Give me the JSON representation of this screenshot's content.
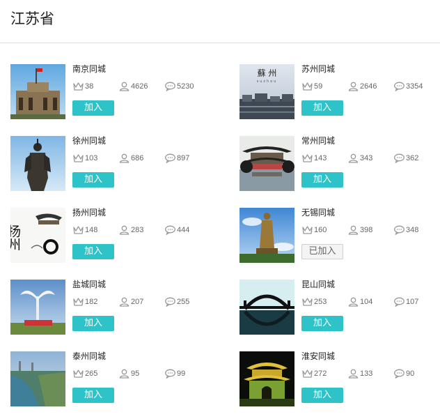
{
  "province": "江苏省",
  "colors": {
    "accent": "#2ec3c8",
    "joined_bg": "#f4f4f4"
  },
  "icons": {
    "crown": "crown-icon",
    "members": "user-icon",
    "posts": "comment-icon"
  },
  "groups": [
    {
      "name": "南京同城",
      "crown": "38",
      "members": "4626",
      "posts": "5230",
      "action": "加入",
      "joined": false
    },
    {
      "name": "苏州同城",
      "crown": "59",
      "members": "2646",
      "posts": "3354",
      "action": "加入",
      "joined": false,
      "thumb_text": "蘇 州",
      "thumb_sub": "suzhou"
    },
    {
      "name": "徐州同城",
      "crown": "103",
      "members": "686",
      "posts": "897",
      "action": "加入",
      "joined": false
    },
    {
      "name": "常州同城",
      "crown": "143",
      "members": "343",
      "posts": "362",
      "action": "加入",
      "joined": false
    },
    {
      "name": "扬州同城",
      "crown": "148",
      "members": "283",
      "posts": "444",
      "action": "加入",
      "joined": false,
      "thumb_text": "扬州"
    },
    {
      "name": "无锡同城",
      "crown": "160",
      "members": "398",
      "posts": "348",
      "action": "已加入",
      "joined": true
    },
    {
      "name": "盐城同城",
      "crown": "182",
      "members": "207",
      "posts": "255",
      "action": "加入",
      "joined": false
    },
    {
      "name": "昆山同城",
      "crown": "253",
      "members": "104",
      "posts": "107",
      "action": "加入",
      "joined": false
    },
    {
      "name": "泰州同城",
      "crown": "265",
      "members": "95",
      "posts": "99",
      "action": "加入",
      "joined": false
    },
    {
      "name": "淮安同城",
      "crown": "272",
      "members": "133",
      "posts": "90",
      "action": "加入",
      "joined": false
    }
  ]
}
